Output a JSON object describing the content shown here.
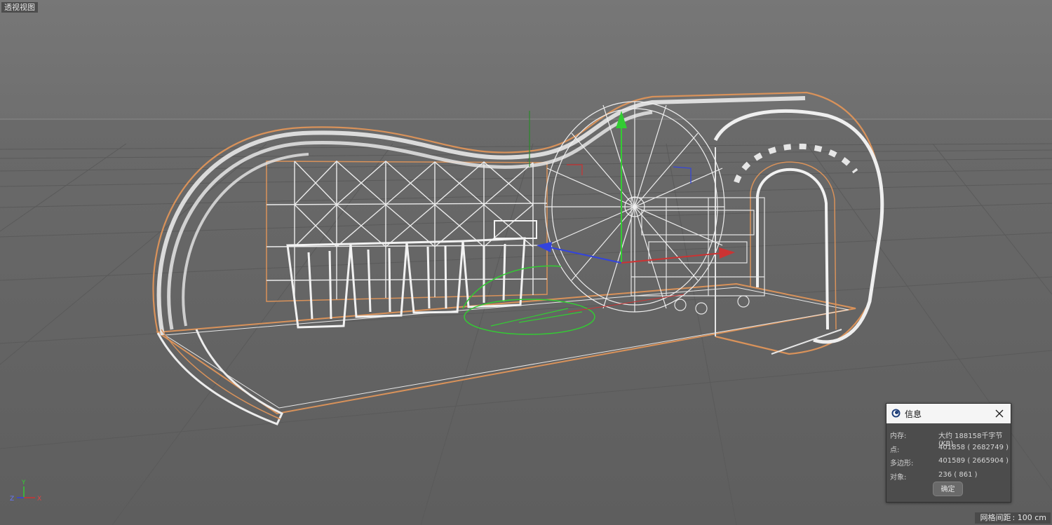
{
  "viewport": {
    "view_label": "透视视图",
    "grid_spacing_label": "网格间距",
    "grid_spacing_value": ": 100 cm"
  },
  "axis_indicator": {
    "y": "Y",
    "z": "Z",
    "x": "X"
  },
  "info_dialog": {
    "title": "信息",
    "rows": [
      {
        "label": "内存:",
        "value": "大约 188158千字节(KB)"
      },
      {
        "label": "点:",
        "value": "401858 ( 2682749 )"
      },
      {
        "label": "多边形:",
        "value": "401589 ( 2665904 )"
      },
      {
        "label": "对象:",
        "value": "236 ( 861 )"
      }
    ],
    "ok_label": "确定"
  },
  "colors": {
    "wire": "#e8e8e8",
    "selection_outline": "#d9925a",
    "axis_x": "#cc3333",
    "axis_y": "#33cc33",
    "axis_z": "#3344dd"
  }
}
